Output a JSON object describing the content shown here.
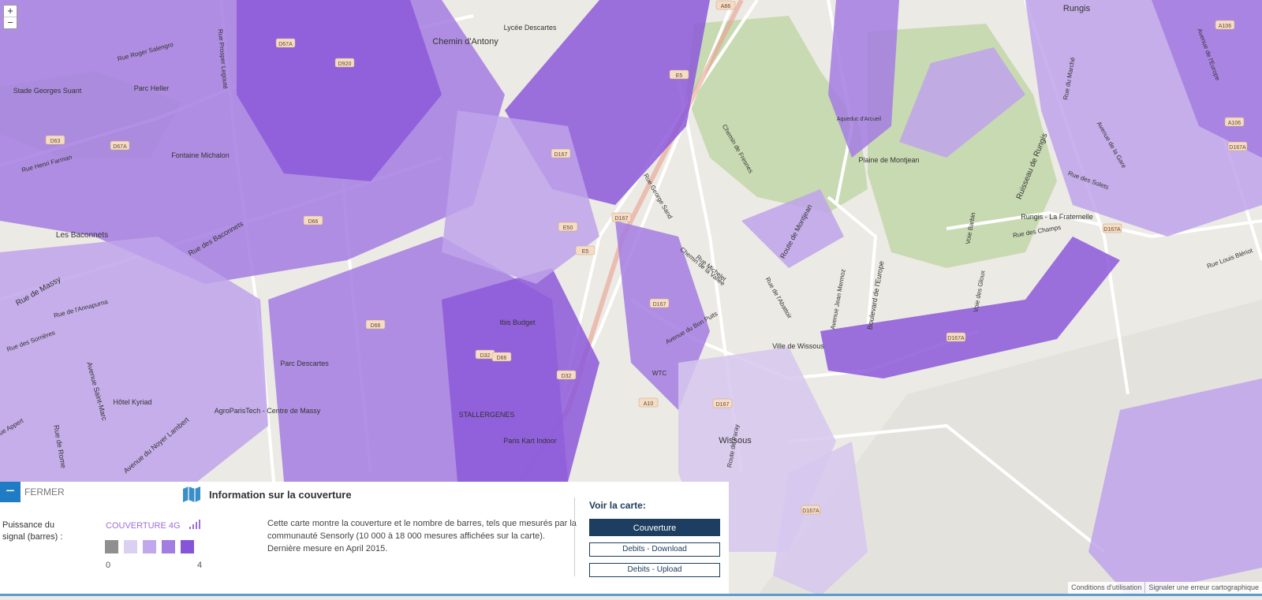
{
  "map": {
    "zoom_in": "+",
    "zoom_out": "−",
    "colors": {
      "background": "#eceae4",
      "green": "#c8dab2",
      "road": "#ffffff",
      "cov4": "#8c58d9",
      "cov3": "#a47de2",
      "cov2": "#bea3ea",
      "cov1": "#d6c7ef"
    },
    "road_labels": [
      "D67A",
      "D920",
      "D63",
      "D67A",
      "D66",
      "D167",
      "D167",
      "D66",
      "D32",
      "D66",
      "A10",
      "D32",
      "D167",
      "D167A",
      "D167A",
      "D167A",
      "A106",
      "A106",
      "A86",
      "E5",
      "E50",
      "E5",
      "D167",
      "D167A"
    ],
    "place_labels": [
      "Chemin d'Antony",
      "Lycée Descartes",
      "Stade Georges Suant",
      "Parc Heller",
      "Fontaine Michalon",
      "Les Baconnets",
      "Ibis Budget",
      "Parc Descartes",
      "Hôtel Kyriad",
      "AgroParisTech - Centre de Massy",
      "STALLERGENES",
      "Paris Kart Indoor",
      "WTC",
      "Ville de Wissous",
      "Wissous",
      "Plaine de Montjean",
      "Rungis - La Fraternelle",
      "Rungis",
      "Aqueduc d'Arcueil",
      "Ruisseau de Rungis",
      "Route de Montjean",
      "Boulevard de l'Europe",
      "Rue Roger Salengro",
      "Rue Henri Farman",
      "Rue de Massy",
      "Rue des Baconnets",
      "Avenue Saint-Marc",
      "Avenue du Noyer Lambert",
      "Rue de Rome",
      "Rue Appert",
      "Rue des Sorrières",
      "Rue de l'Annapurna",
      "Chemin de la Vallée",
      "Rue Michelet",
      "Chemin de Fresnes",
      "Avenue de la Gare",
      "Rue des Solets",
      "Rue des Champs",
      "Voie Barbin",
      "Voie des Gloux",
      "Avenue du Bon Puits",
      "Route de Paray",
      "Rue Louis Blériot",
      "Rue du Marché",
      "Avenue de l'Europe",
      "Rue George Sand",
      "Avenue Jean Mermoz",
      "Rue de l'Abattoir",
      "Rue Prosper Legouté"
    ]
  },
  "panel": {
    "close_label": "FERMER",
    "title": "Information sur la couverture",
    "signal_label_line1": "Puissance du",
    "signal_label_line2": "signal (barres) :",
    "legend_title": "COUVERTURE 4G",
    "legend_min": "0",
    "legend_max": "4",
    "legend_colors": [
      "#8f8f8f",
      "#dcd0f2",
      "#c1a8ec",
      "#a47de2",
      "#8654d6"
    ],
    "description": [
      "Cette carte montre la couverture et le nombre de barres, tels que mesurés par la",
      "communauté Sensorly (10 000 à 18 000 mesures affichées sur la carte).",
      "Dernière mesure en April 2015."
    ],
    "voir_title": "Voir la carte:",
    "buttons": {
      "coverage": "Couverture",
      "download": "Debits - Download",
      "upload": "Debits - Upload"
    }
  },
  "footer": {
    "terms": "Conditions d'utilisation",
    "report": "Signaler une erreur cartographique"
  }
}
